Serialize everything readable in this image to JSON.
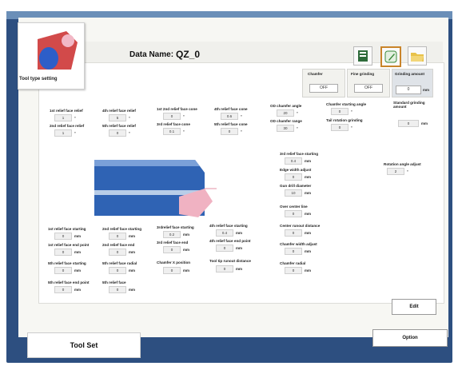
{
  "tool_card": {
    "label": "Tool type setting"
  },
  "header": {
    "data_name_label": "Data Name:",
    "data_name_value": "QZ_0"
  },
  "toolbar_icons": [
    "table-icon",
    "pencil-icon",
    "folder-icon"
  ],
  "top_panels": {
    "chamfer": {
      "title": "Chamfer",
      "value": "OFF"
    },
    "fine_grinding": {
      "title": "Fine grinding",
      "value": "OFF"
    },
    "grinding_amount": {
      "title": "Grinding amount",
      "value": "0",
      "unit": "mm"
    }
  },
  "fields": {
    "relief_1": {
      "label": "1st relief face relief",
      "value": "1",
      "unit": "°"
    },
    "relief_2": {
      "label": "2nd relief face relief",
      "value": "1",
      "unit": "°"
    },
    "relief_4": {
      "label": "4th relief face relief",
      "value": "5",
      "unit": "°"
    },
    "relief_5": {
      "label": "5th relief face relief",
      "value": "0",
      "unit": "°"
    },
    "cone_1_2": {
      "label": "1st 2nd relief face cone",
      "value": "0",
      "unit": "°"
    },
    "cone_3": {
      "label": "3rd relief face cone",
      "value": "0.1",
      "unit": "°"
    },
    "cone_4": {
      "label": "4th relief face cone",
      "value": "0.6",
      "unit": "°"
    },
    "cone_5": {
      "label": "5th relief face cone",
      "value": "0",
      "unit": "°"
    },
    "od_chamfer_angle": {
      "label": "OD chamfer angle",
      "value": "20",
      "unit": "°"
    },
    "od_chamfer_range": {
      "label": "OD chamfer range",
      "value": "30",
      "unit": "°"
    },
    "chamfer_starting_angle": {
      "label": "Chamfer starting angle",
      "value": "0",
      "unit": "°"
    },
    "tail_rotation_grinding": {
      "label": "Tail rotation grinding",
      "value": "0",
      "unit": "°"
    },
    "standard_grinding_amount": {
      "label": "Standard grinding amount",
      "value": "0",
      "unit": "mm"
    },
    "relief_3_starting": {
      "label": "3rd relief face starting",
      "value": "0.4",
      "unit": "mm"
    },
    "edge_width_adjust": {
      "label": "Edge width adjust",
      "value": "0",
      "unit": "mm"
    },
    "gun_drill_diameter": {
      "label": "Gun drill diameter",
      "value": "10",
      "unit": "mm"
    },
    "over_center_line": {
      "label": "Over center line",
      "value": "0",
      "unit": "mm"
    },
    "center_runout": {
      "label": "Center runout distance",
      "value": "0",
      "unit": "mm"
    },
    "chamfer_width_adjust": {
      "label": "Chamfer width adjust",
      "value": "0",
      "unit": "mm"
    },
    "chamfer_radial": {
      "label": "Chamfer radial",
      "value": "0",
      "unit": "mm"
    },
    "rotation_angle_adjust": {
      "label": "Rotation angle adjust",
      "value": "2",
      "unit": "°"
    },
    "start_1": {
      "label": "1st relief face starting",
      "value": "0",
      "unit": "mm"
    },
    "start_2": {
      "label": "2nd relief face starting",
      "value": "0",
      "unit": "mm"
    },
    "start_3": {
      "label": "3rdrelief face starting",
      "value": "0.2",
      "unit": "mm"
    },
    "start_4": {
      "label": "4th relief face starting",
      "value": "0.4",
      "unit": "mm"
    },
    "end_1": {
      "label": "1st relief face end point",
      "value": "0",
      "unit": "mm"
    },
    "end_2": {
      "label": "2nd relief face end",
      "value": "0",
      "unit": "mm"
    },
    "end_3": {
      "label": "3rd relief face end",
      "value": "0",
      "unit": "mm"
    },
    "end_4": {
      "label": "4th relief face end point",
      "value": "0",
      "unit": "mm"
    },
    "start_5": {
      "label": "5th relief face starting",
      "value": "0",
      "unit": "mm"
    },
    "radial_5": {
      "label": "5th relief face radial",
      "value": "0",
      "unit": "mm"
    },
    "chamfer_x_pos": {
      "label": "Chamfer X position",
      "value": "0",
      "unit": "mm"
    },
    "tool_tip_runout": {
      "label": "Tool tip runout distance",
      "value": "0",
      "unit": "mm"
    },
    "end_5": {
      "label": "5th relief face end point",
      "value": "0",
      "unit": "mm"
    },
    "face_5": {
      "label": "5th relief face",
      "value": "0",
      "unit": "mm"
    }
  },
  "buttons": {
    "edit": "Edit",
    "option": "Option",
    "tool_set": "Tool Set"
  }
}
